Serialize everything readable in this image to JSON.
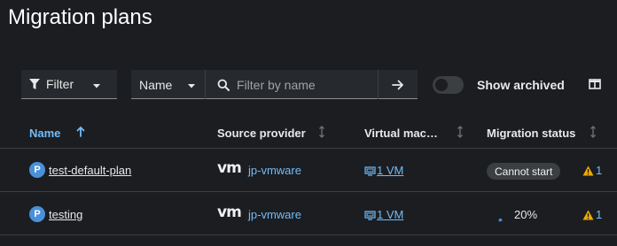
{
  "page": {
    "title": "Migration plans"
  },
  "toolbar": {
    "filter_label": "Filter",
    "attribute_select": "Name",
    "search_placeholder": "Filter by name",
    "search_value": "",
    "show_archived_label": "Show archived",
    "show_archived_on": false
  },
  "table": {
    "headers": {
      "name": "Name",
      "source_provider": "Source provider",
      "virtual_machines": "Virtual mac…",
      "migration_status": "Migration status"
    },
    "sorted_column": "name",
    "sort_direction": "ascending",
    "rows": [
      {
        "badge": "P",
        "name": "test-default-plan",
        "provider_logo": "vm",
        "provider": "jp-vmware",
        "vms": "1 VM",
        "status_type": "pill",
        "status": "Cannot start",
        "warning_count": "1"
      },
      {
        "badge": "P",
        "name": "testing",
        "provider_logo": "vm",
        "provider": "jp-vmware",
        "vms": "1 VM",
        "status_type": "progress",
        "status": "20%",
        "progress_fraction": 0.2,
        "warning_count": "1"
      }
    ]
  },
  "colors": {
    "background": "#1b1d21",
    "link": "#73bcf7",
    "badge": "#4a90d9",
    "warning": "#f0ab00"
  }
}
